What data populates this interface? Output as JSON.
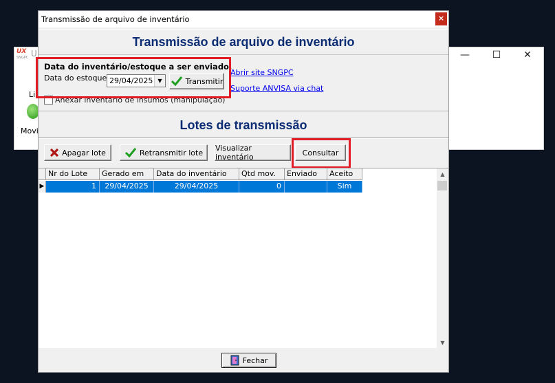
{
  "background_window": {
    "logo": "UX",
    "logo_sub": "SNGPC",
    "title_fragment": "U",
    "label_1": "Li",
    "label_2": "Movin",
    "minimize_glyph": "—",
    "maximize_glyph": "☐",
    "close_glyph": "✕"
  },
  "dialog": {
    "title": "Transmissão de arquivo de inventário",
    "close_glyph": "×",
    "header": "Transmissão de arquivo de inventário",
    "inventory": {
      "group_label": "Data do inventário/estoque a ser enviado.",
      "date_label": "Data do estoque",
      "date_value": "29/04/2025",
      "transmit_label": "Transmitir",
      "attach_label": "Anexar inventário de insumos (manipulação)"
    },
    "links": {
      "sngpc": "Abrir site SNGPC",
      "anvisa": "Suporte ANVISA via chat"
    },
    "lots_header": "Lotes de transmissão",
    "toolbar": {
      "delete_label": "Apagar lote",
      "retransmit_label": "Retransmitir lote",
      "view_label": "Visualizar inventário",
      "query_label": "Consultar"
    },
    "table": {
      "columns": [
        "Nr do Lote",
        "Gerado em",
        "Data do inventário",
        "Qtd mov.",
        "Enviado",
        "Aceito"
      ],
      "rows": [
        {
          "lote": "1",
          "gerado": "29/04/2025",
          "data_inv": "29/04/2025",
          "qtd": "0",
          "enviado": "",
          "aceito": "Sim"
        }
      ]
    },
    "close_label": "Fechar"
  },
  "colors": {
    "header_text": "#0c2c74",
    "highlight_red": "#e21b24",
    "selection": "#0078d7"
  }
}
